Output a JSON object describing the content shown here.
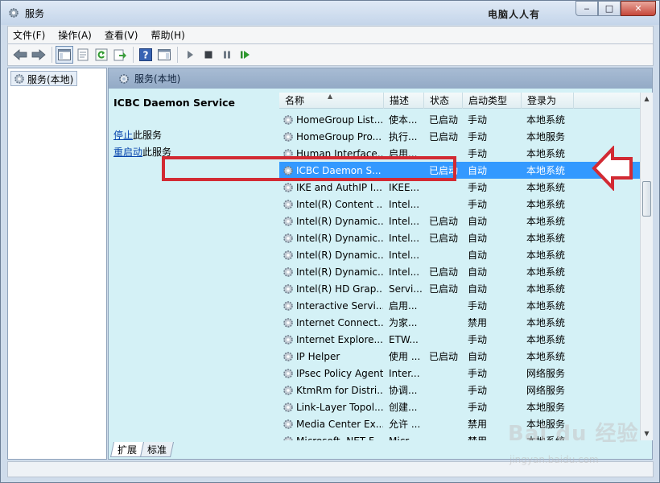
{
  "window": {
    "title": "服务",
    "corner_watermark": "电脑人人有",
    "btn_min": "‒",
    "btn_max": "□",
    "btn_close": "✕"
  },
  "menu": [
    "文件(F)",
    "操作(A)",
    "查看(V)",
    "帮助(H)"
  ],
  "tree": {
    "root": "服务(本地)"
  },
  "panel": {
    "header": "服务(本地)",
    "service_title": "ICBC Daemon Service",
    "stop_link": "停止",
    "stop_suffix": "此服务",
    "restart_link": "重启动",
    "restart_suffix": "此服务"
  },
  "columns": [
    "名称",
    "描述",
    "状态",
    "启动类型",
    "登录为"
  ],
  "rows": [
    {
      "name": "HomeGroup List...",
      "desc": "使本...",
      "status": "已启动",
      "type": "手动",
      "logon": "本地系统"
    },
    {
      "name": "HomeGroup Pro...",
      "desc": "执行...",
      "status": "已启动",
      "type": "手动",
      "logon": "本地服务"
    },
    {
      "name": "Human Interface...",
      "desc": "启用...",
      "status": "",
      "type": "手动",
      "logon": "本地系统"
    },
    {
      "name": "ICBC Daemon S...",
      "desc": "",
      "status": "已启动",
      "type": "自动",
      "logon": "本地系统"
    },
    {
      "name": "IKE and AuthIP I...",
      "desc": "IKEE...",
      "status": "",
      "type": "手动",
      "logon": "本地系统"
    },
    {
      "name": "Intel(R) Content ...",
      "desc": "Intel...",
      "status": "",
      "type": "手动",
      "logon": "本地系统"
    },
    {
      "name": "Intel(R) Dynamic...",
      "desc": "Intel...",
      "status": "已启动",
      "type": "自动",
      "logon": "本地系统"
    },
    {
      "name": "Intel(R) Dynamic...",
      "desc": "Intel...",
      "status": "已启动",
      "type": "自动",
      "logon": "本地系统"
    },
    {
      "name": "Intel(R) Dynamic...",
      "desc": "Intel...",
      "status": "",
      "type": "自动",
      "logon": "本地系统"
    },
    {
      "name": "Intel(R) Dynamic...",
      "desc": "Intel...",
      "status": "已启动",
      "type": "自动",
      "logon": "本地系统"
    },
    {
      "name": "Intel(R) HD Grap...",
      "desc": "Servi...",
      "status": "已启动",
      "type": "自动",
      "logon": "本地系统"
    },
    {
      "name": "Interactive Servi...",
      "desc": "启用...",
      "status": "",
      "type": "手动",
      "logon": "本地系统"
    },
    {
      "name": "Internet Connect...",
      "desc": "为家...",
      "status": "",
      "type": "禁用",
      "logon": "本地系统"
    },
    {
      "name": "Internet Explore...",
      "desc": "ETW...",
      "status": "",
      "type": "手动",
      "logon": "本地系统"
    },
    {
      "name": "IP Helper",
      "desc": "使用 ...",
      "status": "已启动",
      "type": "自动",
      "logon": "本地系统"
    },
    {
      "name": "IPsec Policy Agent",
      "desc": "Inter...",
      "status": "",
      "type": "手动",
      "logon": "网络服务"
    },
    {
      "name": "KtmRm for Distri...",
      "desc": "协调...",
      "status": "",
      "type": "手动",
      "logon": "网络服务"
    },
    {
      "name": "Link-Layer Topol...",
      "desc": "创建...",
      "status": "",
      "type": "手动",
      "logon": "本地服务"
    },
    {
      "name": "Media Center Ex...",
      "desc": "允许 ...",
      "status": "",
      "type": "禁用",
      "logon": "本地服务"
    },
    {
      "name": "Microsoft .NET F...",
      "desc": "Micr...",
      "status": "",
      "type": "禁用",
      "logon": "本地系统"
    }
  ],
  "selected_row": 3,
  "tabs": [
    "扩展",
    "标准"
  ],
  "watermark": {
    "brand": "Bai du 经验",
    "url": "jingyan.baidu.com"
  },
  "colors": {
    "selection": "#3399ff",
    "annotation": "#d22a33",
    "panel_bg": "#d4f1f6"
  },
  "icons": [
    "back-icon",
    "forward-icon",
    "console-tree-icon",
    "properties-icon",
    "refresh-icon",
    "export-icon",
    "help-icon",
    "action-pane-icon",
    "play-icon",
    "stop-icon",
    "pause-icon",
    "restart-icon"
  ]
}
